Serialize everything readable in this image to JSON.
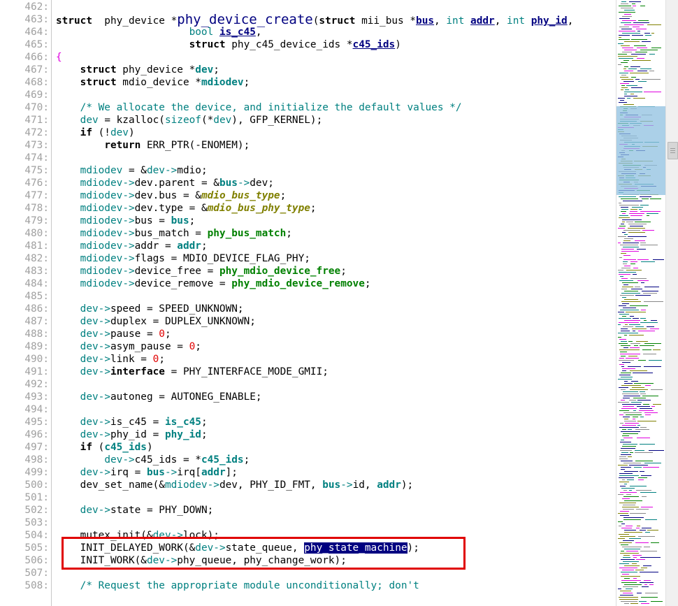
{
  "editor": {
    "lines": [
      {
        "n": "462:",
        "segs": []
      },
      {
        "n": "463:",
        "segs": [
          [
            "kw",
            "struct"
          ],
          [
            "",
            "  phy_device *"
          ],
          [
            "fn-def",
            "phy_device_create"
          ],
          [
            "",
            "("
          ],
          [
            "kw",
            "struct"
          ],
          [
            "",
            " mii_bus *"
          ],
          [
            "param",
            "bus"
          ],
          [
            "",
            ", "
          ],
          [
            "kw2",
            "int"
          ],
          [
            "",
            " "
          ],
          [
            "param",
            "addr"
          ],
          [
            "",
            ", "
          ],
          [
            "kw2",
            "int"
          ],
          [
            "",
            " "
          ],
          [
            "param",
            "phy_id"
          ],
          [
            "",
            ","
          ]
        ]
      },
      {
        "n": "464:",
        "segs": [
          [
            "",
            "                      "
          ],
          [
            "kw2",
            "bool"
          ],
          [
            "",
            " "
          ],
          [
            "param",
            "is_c45"
          ],
          [
            "",
            ","
          ]
        ]
      },
      {
        "n": "465:",
        "segs": [
          [
            "",
            "                      "
          ],
          [
            "kw",
            "struct"
          ],
          [
            "",
            " phy_c45_device_ids *"
          ],
          [
            "param",
            "c45_ids"
          ],
          [
            "",
            ")"
          ]
        ]
      },
      {
        "n": "466:",
        "segs": [
          [
            "op",
            "{"
          ]
        ]
      },
      {
        "n": "467:",
        "segs": [
          [
            "",
            "    "
          ],
          [
            "kw",
            "struct"
          ],
          [
            "",
            " phy_device *"
          ],
          [
            "pbold",
            "dev"
          ],
          [
            "",
            ";"
          ]
        ]
      },
      {
        "n": "468:",
        "segs": [
          [
            "",
            "    "
          ],
          [
            "kw",
            "struct"
          ],
          [
            "",
            " mdio_device *"
          ],
          [
            "pbold",
            "mdiodev"
          ],
          [
            "",
            ";"
          ]
        ]
      },
      {
        "n": "469:",
        "segs": []
      },
      {
        "n": "470:",
        "segs": [
          [
            "",
            "    "
          ],
          [
            "cmt",
            "/* We allocate the device, and initialize the default values */"
          ]
        ]
      },
      {
        "n": "471:",
        "segs": [
          [
            "",
            "    "
          ],
          [
            "var",
            "dev"
          ],
          [
            "",
            " = kzalloc("
          ],
          [
            "kw2",
            "sizeof"
          ],
          [
            "",
            "(*"
          ],
          [
            "var",
            "dev"
          ],
          [
            "",
            "), GFP_KERNEL);"
          ]
        ]
      },
      {
        "n": "472:",
        "segs": [
          [
            "",
            "    "
          ],
          [
            "kw",
            "if"
          ],
          [
            "",
            " (!"
          ],
          [
            "var",
            "dev"
          ],
          [
            "",
            ")"
          ]
        ]
      },
      {
        "n": "473:",
        "segs": [
          [
            "",
            "        "
          ],
          [
            "kw",
            "return"
          ],
          [
            "",
            " ERR_PTR(-ENOMEM);"
          ]
        ]
      },
      {
        "n": "474:",
        "segs": []
      },
      {
        "n": "475:",
        "segs": [
          [
            "",
            "    "
          ],
          [
            "var",
            "mdiodev"
          ],
          [
            "",
            " = &"
          ],
          [
            "var",
            "dev"
          ],
          [
            "arr",
            "->"
          ],
          [
            "",
            "mdio;"
          ]
        ]
      },
      {
        "n": "476:",
        "segs": [
          [
            "",
            "    "
          ],
          [
            "var",
            "mdiodev"
          ],
          [
            "arr",
            "->"
          ],
          [
            "",
            "dev.parent = &"
          ],
          [
            "pbold",
            "bus"
          ],
          [
            "arr",
            "->"
          ],
          [
            "",
            "dev;"
          ]
        ]
      },
      {
        "n": "477:",
        "segs": [
          [
            "",
            "    "
          ],
          [
            "var",
            "mdiodev"
          ],
          [
            "arr",
            "->"
          ],
          [
            "",
            "dev.bus = &"
          ],
          [
            "ty",
            "mdio_bus_type"
          ],
          [
            "",
            ";"
          ]
        ]
      },
      {
        "n": "478:",
        "segs": [
          [
            "",
            "    "
          ],
          [
            "var",
            "mdiodev"
          ],
          [
            "arr",
            "->"
          ],
          [
            "",
            "dev.type = &"
          ],
          [
            "ty",
            "mdio_bus_phy_type"
          ],
          [
            "",
            ";"
          ]
        ]
      },
      {
        "n": "479:",
        "segs": [
          [
            "",
            "    "
          ],
          [
            "var",
            "mdiodev"
          ],
          [
            "arr",
            "->"
          ],
          [
            "",
            "bus = "
          ],
          [
            "pbold",
            "bus"
          ],
          [
            "",
            ";"
          ]
        ]
      },
      {
        "n": "480:",
        "segs": [
          [
            "",
            "    "
          ],
          [
            "var",
            "mdiodev"
          ],
          [
            "arr",
            "->"
          ],
          [
            "",
            "bus_match = "
          ],
          [
            "fnc",
            "phy_bus_match"
          ],
          [
            "",
            ";"
          ]
        ]
      },
      {
        "n": "481:",
        "segs": [
          [
            "",
            "    "
          ],
          [
            "var",
            "mdiodev"
          ],
          [
            "arr",
            "->"
          ],
          [
            "",
            "addr = "
          ],
          [
            "pbold",
            "addr"
          ],
          [
            "",
            ";"
          ]
        ]
      },
      {
        "n": "482:",
        "segs": [
          [
            "",
            "    "
          ],
          [
            "var",
            "mdiodev"
          ],
          [
            "arr",
            "->"
          ],
          [
            "",
            "flags = MDIO_DEVICE_FLAG_PHY;"
          ]
        ]
      },
      {
        "n": "483:",
        "segs": [
          [
            "",
            "    "
          ],
          [
            "var",
            "mdiodev"
          ],
          [
            "arr",
            "->"
          ],
          [
            "",
            "device_free = "
          ],
          [
            "fnc",
            "phy_mdio_device_free"
          ],
          [
            "",
            ";"
          ]
        ]
      },
      {
        "n": "484:",
        "segs": [
          [
            "",
            "    "
          ],
          [
            "var",
            "mdiodev"
          ],
          [
            "arr",
            "->"
          ],
          [
            "",
            "device_remove = "
          ],
          [
            "fnc",
            "phy_mdio_device_remove"
          ],
          [
            "",
            ";"
          ]
        ]
      },
      {
        "n": "485:",
        "segs": []
      },
      {
        "n": "486:",
        "segs": [
          [
            "",
            "    "
          ],
          [
            "var",
            "dev"
          ],
          [
            "arr",
            "->"
          ],
          [
            "",
            "speed = SPEED_UNKNOWN;"
          ]
        ]
      },
      {
        "n": "487:",
        "segs": [
          [
            "",
            "    "
          ],
          [
            "var",
            "dev"
          ],
          [
            "arr",
            "->"
          ],
          [
            "",
            "duplex = DUPLEX_UNKNOWN;"
          ]
        ]
      },
      {
        "n": "488:",
        "segs": [
          [
            "",
            "    "
          ],
          [
            "var",
            "dev"
          ],
          [
            "arr",
            "->"
          ],
          [
            "",
            "pause = "
          ],
          [
            "num",
            "0"
          ],
          [
            "",
            ";"
          ]
        ]
      },
      {
        "n": "489:",
        "segs": [
          [
            "",
            "    "
          ],
          [
            "var",
            "dev"
          ],
          [
            "arr",
            "->"
          ],
          [
            "",
            "asym_pause = "
          ],
          [
            "num",
            "0"
          ],
          [
            "",
            ";"
          ]
        ]
      },
      {
        "n": "490:",
        "segs": [
          [
            "",
            "    "
          ],
          [
            "var",
            "dev"
          ],
          [
            "arr",
            "->"
          ],
          [
            "",
            "link = "
          ],
          [
            "num",
            "0"
          ],
          [
            "",
            ";"
          ]
        ]
      },
      {
        "n": "491:",
        "segs": [
          [
            "",
            "    "
          ],
          [
            "var",
            "dev"
          ],
          [
            "arr",
            "->"
          ],
          [
            "kw",
            "interface"
          ],
          [
            "",
            " = PHY_INTERFACE_MODE_GMII;"
          ]
        ]
      },
      {
        "n": "492:",
        "segs": []
      },
      {
        "n": "493:",
        "segs": [
          [
            "",
            "    "
          ],
          [
            "var",
            "dev"
          ],
          [
            "arr",
            "->"
          ],
          [
            "",
            "autoneg = AUTONEG_ENABLE;"
          ]
        ]
      },
      {
        "n": "494:",
        "segs": []
      },
      {
        "n": "495:",
        "segs": [
          [
            "",
            "    "
          ],
          [
            "var",
            "dev"
          ],
          [
            "arr",
            "->"
          ],
          [
            "",
            "is_c45 = "
          ],
          [
            "pbold",
            "is_c45"
          ],
          [
            "",
            ";"
          ]
        ]
      },
      {
        "n": "496:",
        "segs": [
          [
            "",
            "    "
          ],
          [
            "var",
            "dev"
          ],
          [
            "arr",
            "->"
          ],
          [
            "",
            "phy_id = "
          ],
          [
            "pbold",
            "phy_id"
          ],
          [
            "",
            ";"
          ]
        ]
      },
      {
        "n": "497:",
        "segs": [
          [
            "",
            "    "
          ],
          [
            "kw",
            "if"
          ],
          [
            "",
            " ("
          ],
          [
            "pbold",
            "c45_ids"
          ],
          [
            "",
            ")"
          ]
        ]
      },
      {
        "n": "498:",
        "segs": [
          [
            "",
            "        "
          ],
          [
            "var",
            "dev"
          ],
          [
            "arr",
            "->"
          ],
          [
            "",
            "c45_ids = *"
          ],
          [
            "pbold",
            "c45_ids"
          ],
          [
            "",
            ";"
          ]
        ]
      },
      {
        "n": "499:",
        "segs": [
          [
            "",
            "    "
          ],
          [
            "var",
            "dev"
          ],
          [
            "arr",
            "->"
          ],
          [
            "",
            "irq = "
          ],
          [
            "pbold",
            "bus"
          ],
          [
            "arr",
            "->"
          ],
          [
            "",
            "irq["
          ],
          [
            "pbold",
            "addr"
          ],
          [
            "",
            "];"
          ]
        ]
      },
      {
        "n": "500:",
        "segs": [
          [
            "",
            "    dev_set_name(&"
          ],
          [
            "var",
            "mdiodev"
          ],
          [
            "arr",
            "->"
          ],
          [
            "",
            "dev, PHY_ID_FMT, "
          ],
          [
            "pbold",
            "bus"
          ],
          [
            "arr",
            "->"
          ],
          [
            "",
            "id, "
          ],
          [
            "pbold",
            "addr"
          ],
          [
            "",
            ");"
          ]
        ]
      },
      {
        "n": "501:",
        "segs": []
      },
      {
        "n": "502:",
        "segs": [
          [
            "",
            "    "
          ],
          [
            "var",
            "dev"
          ],
          [
            "arr",
            "->"
          ],
          [
            "",
            "state = PHY_DOWN;"
          ]
        ]
      },
      {
        "n": "503:",
        "segs": []
      },
      {
        "n": "504:",
        "segs": [
          [
            "",
            "    mutex_init(&"
          ],
          [
            "var",
            "dev"
          ],
          [
            "arr",
            "->"
          ],
          [
            "",
            "lock);"
          ]
        ]
      },
      {
        "n": "505:",
        "segs": [
          [
            "",
            "    INIT_DELAYED_WORK(&"
          ],
          [
            "var",
            "dev"
          ],
          [
            "arr",
            "->"
          ],
          [
            "",
            "state_queue, "
          ],
          [
            "hl",
            "phy_state_machine"
          ],
          [
            "",
            ");"
          ]
        ]
      },
      {
        "n": "506:",
        "segs": [
          [
            "",
            "    INIT_WORK(&"
          ],
          [
            "var",
            "dev"
          ],
          [
            "arr",
            "->"
          ],
          [
            "",
            "phy_queue, phy_change_work);"
          ]
        ]
      },
      {
        "n": "507:",
        "segs": []
      },
      {
        "n": "508:",
        "segs": [
          [
            "",
            "    "
          ],
          [
            "cmt",
            "/* Request the appropriate module unconditionally; don't"
          ]
        ]
      }
    ]
  },
  "minimap": {
    "viewport_color": "#8fc0e0"
  },
  "colors": {
    "highlight_box": "#e00000",
    "line_number": "#a0a0a0"
  }
}
